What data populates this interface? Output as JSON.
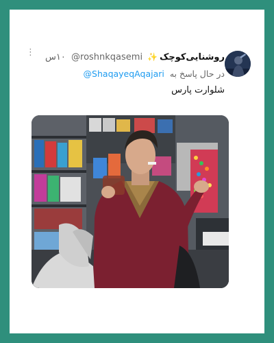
{
  "tweet": {
    "display_name": "روشنایی‌کوچک",
    "handle": "@roshnkqasemi",
    "time": "۱۰س",
    "reply_prefix": "در حال پاسخ به",
    "reply_to": "@ShaqayeqAqajari",
    "text": "شلوارت پارس",
    "more_glyph": "⋮",
    "sparkle_glyph": "✨"
  },
  "colors": {
    "frame": "#2f8f7c",
    "card": "#ffffff",
    "link": "#1d9bf0",
    "jacket": "#7b2030"
  },
  "icons": [
    "more-options-icon",
    "sparkle-icon"
  ]
}
